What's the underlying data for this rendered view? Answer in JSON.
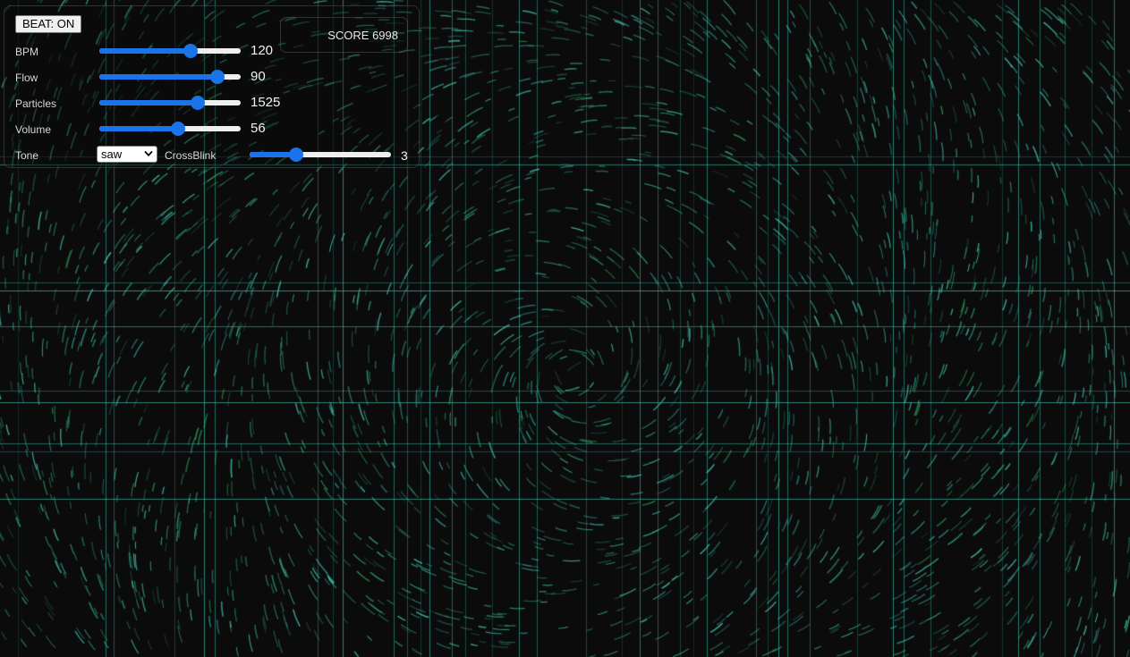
{
  "controls": {
    "beat_button": "BEAT: ON",
    "sliders": [
      {
        "key": "bpm",
        "label": "BPM",
        "value": "120",
        "fraction": 0.66
      },
      {
        "key": "flow",
        "label": "Flow",
        "value": "90",
        "fraction": 0.87
      },
      {
        "key": "particles",
        "label": "Particles",
        "value": "1525",
        "fraction": 0.72
      },
      {
        "key": "volume",
        "label": "Volume",
        "value": "56",
        "fraction": 0.56
      }
    ],
    "tone": {
      "label": "Tone",
      "selected": "saw"
    },
    "crossblink": {
      "label": "CrossBlink",
      "value": "3",
      "fraction": 0.31
    }
  },
  "score": {
    "text": "SCORE 6998"
  },
  "colors": {
    "background": "#0b0b0b",
    "accent": "#1a73e8",
    "streak_teal": "#3fbfa8",
    "streak_green": "#2e9a5a",
    "grid_line": "#3fc8b4"
  },
  "icons": {
    "select_arrow": "chevron-down-icon"
  }
}
